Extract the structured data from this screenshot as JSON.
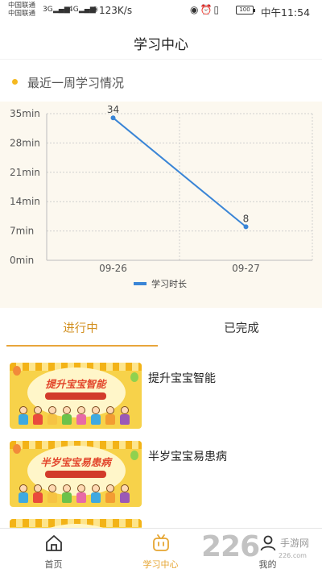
{
  "status_bar": {
    "carrier1": "中国联通",
    "carrier2": "中国联通",
    "net1": "3G",
    "net2": "4G",
    "speed": "123K/s",
    "battery": "100",
    "time": "中午11:54"
  },
  "header": {
    "title": "学习中心"
  },
  "section": {
    "title": "最近一周学习情况"
  },
  "chart_data": {
    "type": "line",
    "title": "",
    "xlabel": "",
    "ylabel": "",
    "x": [
      "09-26",
      "09-27"
    ],
    "series": [
      {
        "name": "学习时长",
        "values": [
          34,
          8
        ],
        "color": "#3a85d6"
      }
    ],
    "ylim": [
      0,
      35
    ],
    "yticks": [
      "0min",
      "7min",
      "14min",
      "21min",
      "28min",
      "35min"
    ],
    "data_labels": [
      "34",
      "8"
    ],
    "grid": true,
    "legend": "bottom"
  },
  "tabs": [
    {
      "label": "进行中",
      "active": true
    },
    {
      "label": "已完成",
      "active": false
    }
  ],
  "courses": [
    {
      "title": "提升宝宝智能",
      "thumb_title": "提升宝宝智能"
    },
    {
      "title": "半岁宝宝易患病",
      "thumb_title": "半岁宝宝易患病"
    },
    {
      "title": ""
    }
  ],
  "bottom_nav": [
    {
      "label": "首页",
      "icon": "home-icon",
      "active": false
    },
    {
      "label": "学习中心",
      "icon": "study-icon",
      "active": true
    },
    {
      "label": "我的",
      "icon": "profile-icon",
      "active": false
    }
  ],
  "watermark": {
    "big": "226",
    "site1": "手游网",
    "site2": "226.com"
  },
  "colors": {
    "accent": "#e6a531",
    "line": "#3a85d6",
    "chart_bg": "#fcf8ef"
  }
}
